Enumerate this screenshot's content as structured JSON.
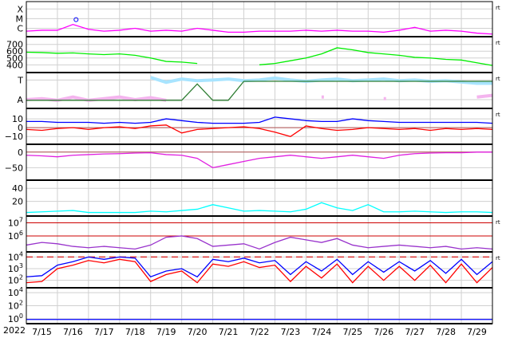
{
  "chart_data": {
    "type": "line",
    "title": "",
    "year_label": "2022",
    "x_tick_labels": [
      "7/15",
      "7/16",
      "7/17",
      "7/18",
      "7/19",
      "7/20",
      "7/21",
      "7/22",
      "7/23",
      "7/24",
      "7/25",
      "7/26",
      "7/27",
      "7/28",
      "7/29"
    ],
    "x_unit": "days since 7/15 00:00, sampled every 0.5 day",
    "xlim": [
      0,
      15
    ],
    "panels": [
      {
        "id": "xray",
        "scale": "log10",
        "ylim": [
          -6.7,
          -3.4
        ],
        "ticks": [
          {
            "v": -4,
            "label": "X"
          },
          {
            "v": -5,
            "label": "M"
          },
          {
            "v": -6,
            "label": "C"
          }
        ],
        "rt": "rt",
        "series": [
          {
            "name": "X-ray flux",
            "color": "#ff00ff",
            "values": [
              -6.3,
              -6.2,
              -6.2,
              -5.6,
              -6.1,
              -6.3,
              -6.2,
              -6.0,
              -6.3,
              -6.2,
              -6.3,
              -6.0,
              -6.2,
              -6.4,
              -6.4,
              -6.3,
              -6.3,
              -6.3,
              -6.2,
              -6.3,
              -6.2,
              -6.3,
              -6.3,
              -6.4,
              -6.2,
              -5.9,
              -6.3,
              -6.2,
              -6.3,
              -6.5,
              -6.6
            ]
          }
        ],
        "markers": [
          {
            "t": 1.6,
            "v": -5.1,
            "color": "#0000ff"
          }
        ]
      },
      {
        "id": "speed",
        "scale": "linear",
        "ylim": [
          310,
          790
        ],
        "ticks": [
          {
            "v": 700,
            "label": "700"
          },
          {
            "v": 600,
            "label": "600"
          },
          {
            "v": 500,
            "label": "500"
          },
          {
            "v": 400,
            "label": "400"
          }
        ],
        "rt": "rt",
        "series": [
          {
            "name": "Solar wind speed",
            "color": "#00ee00",
            "values": [
              585,
              580,
              570,
              575,
              560,
              550,
              560,
              540,
              500,
              450,
              440,
              420,
              null,
              null,
              null,
              400,
              420,
              460,
              500,
              560,
              650,
              620,
              580,
              560,
              540,
              510,
              500,
              480,
              470,
              430,
              390
            ]
          }
        ]
      },
      {
        "id": "imf-sector",
        "scale": "category",
        "ylim": [
          0,
          1
        ],
        "ticks": [
          {
            "v": 0.82,
            "label": "T"
          },
          {
            "v": 0.22,
            "label": "A"
          }
        ],
        "rt": "rt",
        "series": [
          {
            "name": "Toward",
            "color": "#a8e4ff",
            "values": [
              null,
              null,
              null,
              null,
              null,
              null,
              null,
              null,
              0.9,
              0.75,
              0.85,
              0.8,
              0.82,
              0.85,
              0.8,
              0.82,
              0.88,
              0.82,
              0.78,
              0.82,
              0.85,
              0.8,
              0.82,
              0.85,
              0.8,
              0.82,
              0.78,
              0.8,
              0.76,
              0.72,
              0.72
            ]
          },
          {
            "name": "Away",
            "color": "#f4b4ee",
            "values": [
              0.22,
              0.25,
              0.2,
              0.3,
              0.2,
              0.25,
              0.3,
              0.22,
              0.28,
              0.2,
              null,
              null,
              null,
              null,
              null,
              null,
              null,
              null,
              null,
              0.3,
              null,
              null,
              null,
              0.25,
              null,
              null,
              null,
              null,
              null,
              0.3,
              0.35
            ]
          },
          {
            "name": "Sector",
            "color": "#2e7d32",
            "values": [
              0.2,
              0.2,
              0.2,
              0.2,
              0.2,
              0.2,
              0.2,
              0.2,
              0.2,
              0.2,
              0.2,
              0.7,
              0.2,
              0.2,
              0.78,
              0.78,
              0.78,
              0.78,
              0.78,
              0.78,
              0.78,
              0.78,
              0.78,
              0.78,
              0.78,
              0.78,
              0.78,
              0.78,
              0.78,
              0.78,
              0.78
            ]
          }
        ]
      },
      {
        "id": "bz",
        "scale": "linear",
        "ylim": [
          -17,
          20
        ],
        "ticks": [
          {
            "v": 10,
            "label": "10"
          },
          {
            "v": 0,
            "label": "0"
          },
          {
            "v": -10,
            "label": "−10"
          }
        ],
        "rt": "rt",
        "zero": true,
        "series": [
          {
            "name": "Bt",
            "color": "#0000ff",
            "values": [
              7,
              7,
              6,
              6,
              6,
              5,
              6,
              5,
              6,
              10,
              8,
              6,
              5,
              5,
              5,
              6,
              12,
              10,
              8,
              7,
              7,
              10,
              8,
              7,
              6,
              6,
              6,
              6,
              6,
              6,
              5
            ]
          },
          {
            "name": "Bz",
            "color": "#ff0000",
            "values": [
              -2,
              -3,
              -1,
              0,
              -2,
              0,
              1,
              -1,
              2,
              3,
              -6,
              -2,
              -1,
              0,
              1,
              -1,
              -5,
              -10,
              2,
              -1,
              -3,
              -2,
              0,
              -1,
              -2,
              -1,
              -3,
              -1,
              -2,
              -1,
              -2
            ]
          }
        ]
      },
      {
        "id": "phi",
        "scale": "linear",
        "ylim": [
          -85,
          20
        ],
        "ticks": [
          {
            "v": 0,
            "label": "0"
          },
          {
            "v": -50,
            "label": "−50"
          }
        ],
        "zero": true,
        "series": [
          {
            "name": "Phi",
            "color": "#e020e0",
            "values": [
              -10,
              -12,
              -15,
              -10,
              -8,
              -6,
              -5,
              -3,
              -2,
              -8,
              -10,
              -20,
              -50,
              -40,
              -30,
              -20,
              -15,
              -10,
              -15,
              -20,
              -15,
              -10,
              -15,
              -20,
              -10,
              -5,
              -3,
              -2,
              -2,
              0,
              0
            ]
          }
        ]
      },
      {
        "id": "density",
        "scale": "linear",
        "ylim": [
          0,
          50
        ],
        "ticks": [
          {
            "v": 40,
            "label": "40"
          },
          {
            "v": 20,
            "label": "20"
          }
        ],
        "series": [
          {
            "name": "Density",
            "color": "#00ffff",
            "values": [
              3,
              4,
              5,
              6,
              3,
              3,
              3,
              3,
              5,
              4,
              6,
              8,
              15,
              10,
              5,
              6,
              5,
              4,
              8,
              18,
              10,
              6,
              15,
              4,
              4,
              5,
              4,
              3,
              4,
              4,
              3
            ]
          }
        ]
      },
      {
        "id": "proton",
        "scale": "log10",
        "ylim": [
          4.9,
          7.4
        ],
        "ticks": [
          {
            "v": 7,
            "label": "10^7"
          },
          {
            "v": 6,
            "label": "10^6"
          }
        ],
        "rt": "rt",
        "hlines": [
          7,
          6
        ],
        "series": [
          {
            "name": "Protons",
            "color": "#9933cc",
            "values": [
              5.3,
              5.5,
              5.4,
              5.2,
              5.1,
              5.2,
              5.1,
              5.0,
              5.3,
              5.9,
              6.0,
              5.8,
              5.2,
              5.3,
              5.4,
              5.0,
              5.5,
              5.9,
              5.7,
              5.5,
              5.8,
              5.3,
              5.1,
              5.2,
              5.3,
              5.2,
              5.1,
              5.2,
              5.0,
              5.1,
              5.0
            ]
          }
        ]
      },
      {
        "id": "electron",
        "scale": "log10",
        "ylim": [
          1.5,
          4.3
        ],
        "ticks": [
          {
            "v": 4,
            "label": "10^4"
          },
          {
            "v": 3,
            "label": "10^3"
          },
          {
            "v": 2,
            "label": "10^2"
          }
        ],
        "rt": "rt",
        "dashed": 4,
        "series": [
          {
            "name": ">2 MeV electrons (blue)",
            "color": "#0000ff",
            "values": [
              2.3,
              2.4,
              3.3,
              3.6,
              4.0,
              3.8,
              4.0,
              3.9,
              2.3,
              2.8,
              3.0,
              2.3,
              3.8,
              3.6,
              3.9,
              3.5,
              3.7,
              2.5,
              3.6,
              2.8,
              3.8,
              2.5,
              3.6,
              2.7,
              3.6,
              2.8,
              3.7,
              2.6,
              3.8,
              2.5,
              3.6
            ]
          },
          {
            "name": "electrons (red)",
            "color": "#ff0000",
            "values": [
              1.8,
              1.9,
              3.0,
              3.3,
              3.7,
              3.5,
              3.8,
              3.6,
              1.9,
              2.5,
              2.8,
              1.8,
              3.4,
              3.2,
              3.6,
              3.1,
              3.3,
              1.9,
              3.2,
              2.2,
              3.4,
              1.8,
              3.2,
              2.0,
              3.2,
              2.0,
              3.3,
              1.8,
              3.4,
              1.8,
              3.1
            ]
          }
        ]
      },
      {
        "id": "bottom",
        "scale": "log10",
        "ylim": [
          -0.5,
          4.5
        ],
        "ticks": [
          {
            "v": 4,
            "label": "10^4"
          },
          {
            "v": 2,
            "label": "10^2"
          },
          {
            "v": 0,
            "label": "10^0"
          }
        ],
        "series": [
          {
            "name": "Flux",
            "color": "#0000ff",
            "values": [
              -0.1,
              -0.1,
              -0.1,
              -0.1,
              -0.1,
              -0.1,
              -0.1,
              -0.1,
              -0.1,
              -0.1,
              -0.1,
              -0.1,
              -0.1,
              -0.1,
              -0.1,
              -0.1,
              -0.1,
              -0.1,
              -0.1,
              -0.1,
              -0.1,
              -0.1,
              -0.1,
              -0.1,
              -0.1,
              -0.1,
              -0.1,
              -0.1,
              -0.1,
              -0.1,
              -0.1
            ]
          }
        ]
      }
    ]
  }
}
